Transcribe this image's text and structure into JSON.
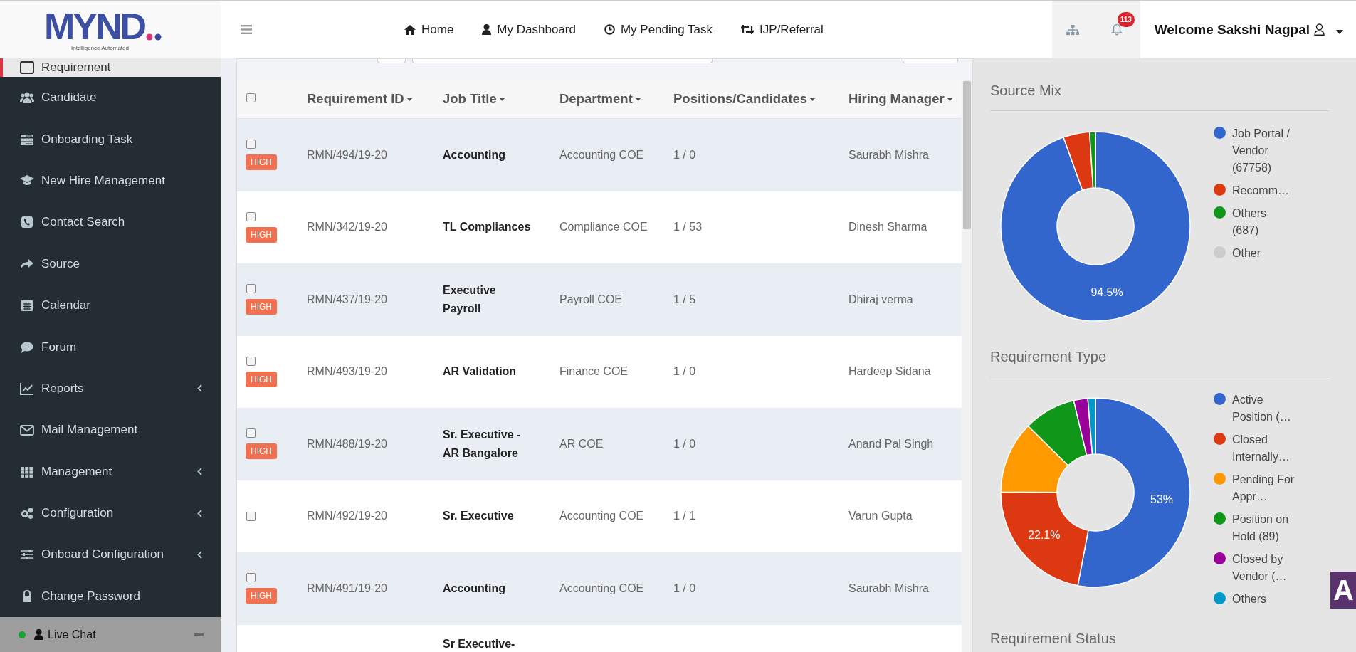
{
  "header": {
    "logo": {
      "text": "MYND",
      "tagline": "Intelligence Automated"
    },
    "nav": [
      {
        "label": "Home"
      },
      {
        "label": "My Dashboard"
      },
      {
        "label": "My Pending Task"
      },
      {
        "label": "IJP/Referral"
      }
    ],
    "notification_count": "113",
    "welcome": "Welcome Sakshi Nagpal"
  },
  "sidebar": {
    "items": [
      {
        "label": "Requirement",
        "selected": true,
        "submenu": false
      },
      {
        "label": "Candidate",
        "selected": false,
        "submenu": false
      },
      {
        "label": "Onboarding Task",
        "selected": false,
        "submenu": false
      },
      {
        "label": "New Hire Management",
        "selected": false,
        "submenu": false
      },
      {
        "label": "Contact Search",
        "selected": false,
        "submenu": false
      },
      {
        "label": "Source",
        "selected": false,
        "submenu": false
      },
      {
        "label": "Calendar",
        "selected": false,
        "submenu": false
      },
      {
        "label": "Forum",
        "selected": false,
        "submenu": false
      },
      {
        "label": "Reports",
        "selected": false,
        "submenu": true
      },
      {
        "label": "Mail Management",
        "selected": false,
        "submenu": false
      },
      {
        "label": "Management",
        "selected": false,
        "submenu": true
      },
      {
        "label": "Configuration",
        "selected": false,
        "submenu": true
      },
      {
        "label": "Onboard Configuration",
        "selected": false,
        "submenu": true
      },
      {
        "label": "Change Password",
        "selected": false,
        "submenu": false
      }
    ],
    "live_chat": {
      "label": "Live Chat",
      "online": true
    }
  },
  "table": {
    "select_all_checked": false,
    "columns": [
      {
        "label": "Requirement ID"
      },
      {
        "label": "Job Title"
      },
      {
        "label": "Department"
      },
      {
        "label": "Positions/Candidates"
      },
      {
        "label": "Hiring Manager"
      }
    ],
    "rows": [
      {
        "checked": false,
        "priority": "HIGH",
        "id": "RMN/494/19-20",
        "title": "Accounting",
        "department": "Accounting COE",
        "positions": "1 / 0",
        "manager": "Saurabh Mishra"
      },
      {
        "checked": false,
        "priority": "HIGH",
        "id": "RMN/342/19-20",
        "title": "TL Compliances",
        "department": "Compliance COE",
        "positions": "1 / 53",
        "manager": "Dinesh Sharma"
      },
      {
        "checked": false,
        "priority": "HIGH",
        "id": "RMN/437/19-20",
        "title": "Executive Payroll",
        "department": "Payroll COE",
        "positions": "1 / 5",
        "manager": "Dhiraj verma"
      },
      {
        "checked": false,
        "priority": "HIGH",
        "id": "RMN/493/19-20",
        "title": "AR Validation",
        "department": "Finance COE",
        "positions": "1 / 0",
        "manager": "Hardeep Sidana"
      },
      {
        "checked": false,
        "priority": "HIGH",
        "id": "RMN/488/19-20",
        "title": "Sr. Executive - AR Bangalore",
        "department": "AR COE",
        "positions": "1 / 0",
        "manager": "Anand Pal Singh"
      },
      {
        "checked": false,
        "id": "RMN/492/19-20",
        "title": "Sr. Executive",
        "department": "Accounting COE",
        "positions": "1 / 1",
        "manager": "Varun Gupta"
      },
      {
        "checked": false,
        "priority": "HIGH",
        "id": "RMN/491/19-20",
        "title": "Accounting",
        "department": "Accounting COE",
        "positions": "1 / 0",
        "manager": "Saurabh Mishra"
      },
      {
        "title": "Sr Executive-"
      }
    ]
  },
  "panels": [
    {
      "title": "Source Mix",
      "chart_data": {
        "type": "donut",
        "legend": "right",
        "categories": [
          "Job Portal / Vendor (67758)",
          "Recomm…",
          "Others (687)",
          "Other"
        ],
        "values": [
          94.5,
          4.5,
          1.0,
          0
        ],
        "colors": [
          "#3366cc",
          "#dc3912",
          "#109618",
          "#cccccc"
        ],
        "value_labels": [
          "94.5%",
          null,
          null,
          null
        ]
      }
    },
    {
      "title": "Requirement Type",
      "chart_data": {
        "type": "donut",
        "legend": "right",
        "categories": [
          "Active Position (…",
          "Closed Internally…",
          "Pending For Appr…",
          "Position on Hold (89)",
          "Closed by Vendor (…",
          "Others"
        ],
        "values": [
          53,
          22.1,
          12.3,
          8.9,
          2.4,
          1.3
        ],
        "colors": [
          "#3366cc",
          "#dc3912",
          "#ff9900",
          "#109618",
          "#990099",
          "#0099c6"
        ],
        "value_labels": [
          "53%",
          "22.1%",
          null,
          null,
          null,
          null
        ]
      }
    },
    {
      "title": "Requirement Status"
    }
  ],
  "side_widget": {
    "label": "A"
  }
}
